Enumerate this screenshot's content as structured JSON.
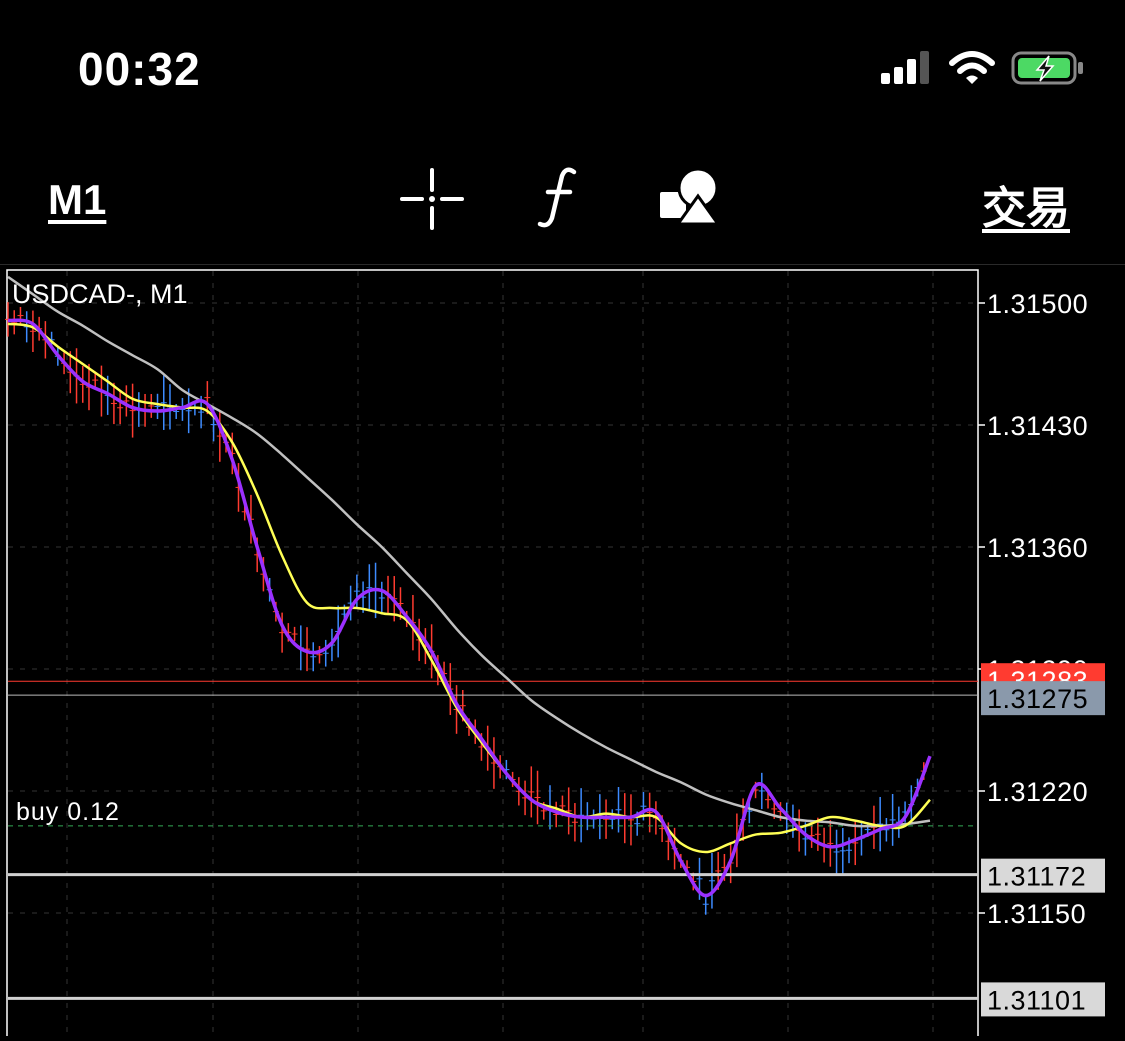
{
  "status_bar": {
    "time": "00:32",
    "icons": [
      "cellular-signal-icon",
      "wifi-icon",
      "battery-charging-icon"
    ]
  },
  "toolbar": {
    "timeframe_label": "M1",
    "trade_label": "交易",
    "icons": [
      "crosshair-icon",
      "indicators-function-icon",
      "objects-shapes-icon"
    ]
  },
  "chart": {
    "symbol_label": "USDCAD-, M1",
    "buy_label": "buy 0.12",
    "colors": {
      "fast_ma": "#9b30ff",
      "mid_ma": "#ffff55",
      "slow_ma": "#c0c0c0",
      "bid_line": "#ff3b30",
      "ask_tag": "#8a99ab",
      "up_bar": "#3d8bff",
      "down_bar": "#ff3b30",
      "level_line": "#d0d0d0",
      "order_line": "#33aa55"
    }
  },
  "chart_data": {
    "type": "line",
    "symbol": "USDCAD-",
    "timeframe": "M1",
    "y_axis_ticks": [
      "1.31500",
      "1.31430",
      "1.31360",
      "1.31290",
      "1.31220",
      "1.31150"
    ],
    "ylim": [
      1.3109,
      1.3152
    ],
    "price_tags": {
      "bid": "1.31283",
      "ask": "1.31275",
      "level_high": "1.31172",
      "level_low": "1.31101"
    },
    "order": {
      "label": "buy 0.12",
      "price": 1.312
    },
    "series": [
      {
        "values": [
          1.3149,
          1.31488,
          1.3147,
          1.31455,
          1.31448,
          1.3144,
          1.31438,
          1.3144,
          1.31442,
          1.3141,
          1.3136,
          1.31315,
          1.313,
          1.31305,
          1.3133,
          1.31335,
          1.3132,
          1.313,
          1.3127,
          1.3125,
          1.3123,
          1.31215,
          1.31208,
          1.31205,
          1.31205,
          1.31205,
          1.31208,
          1.3118,
          1.3116,
          1.3118,
          1.31223,
          1.3121,
          1.31195,
          1.31188,
          1.31192,
          1.31198,
          1.31205,
          1.3124
        ]
      },
      {
        "values": [
          1.31488,
          1.31486,
          1.31475,
          1.31465,
          1.31455,
          1.31445,
          1.31442,
          1.3144,
          1.31438,
          1.3142,
          1.3139,
          1.31355,
          1.31328,
          1.31325,
          1.31325,
          1.31322,
          1.31318,
          1.31295,
          1.31268,
          1.31248,
          1.3123,
          1.31215,
          1.3121,
          1.31205,
          1.31207,
          1.31205,
          1.31205,
          1.3119,
          1.31185,
          1.3119,
          1.31195,
          1.31196,
          1.312,
          1.31205,
          1.31203,
          1.312,
          1.312,
          1.31215
        ]
      },
      {
        "values": [
          1.31515,
          1.31505,
          1.31495,
          1.31487,
          1.31478,
          1.3147,
          1.31462,
          1.3145,
          1.31442,
          1.31434,
          1.31425,
          1.31413,
          1.314,
          1.31387,
          1.31373,
          1.3136,
          1.31345,
          1.3133,
          1.31313,
          1.31298,
          1.31285,
          1.31272,
          1.31262,
          1.31253,
          1.31245,
          1.31238,
          1.31231,
          1.31225,
          1.31218,
          1.31213,
          1.31209,
          1.31205,
          1.31203,
          1.31202,
          1.312,
          1.312,
          1.31201,
          1.31203
        ]
      }
    ]
  }
}
